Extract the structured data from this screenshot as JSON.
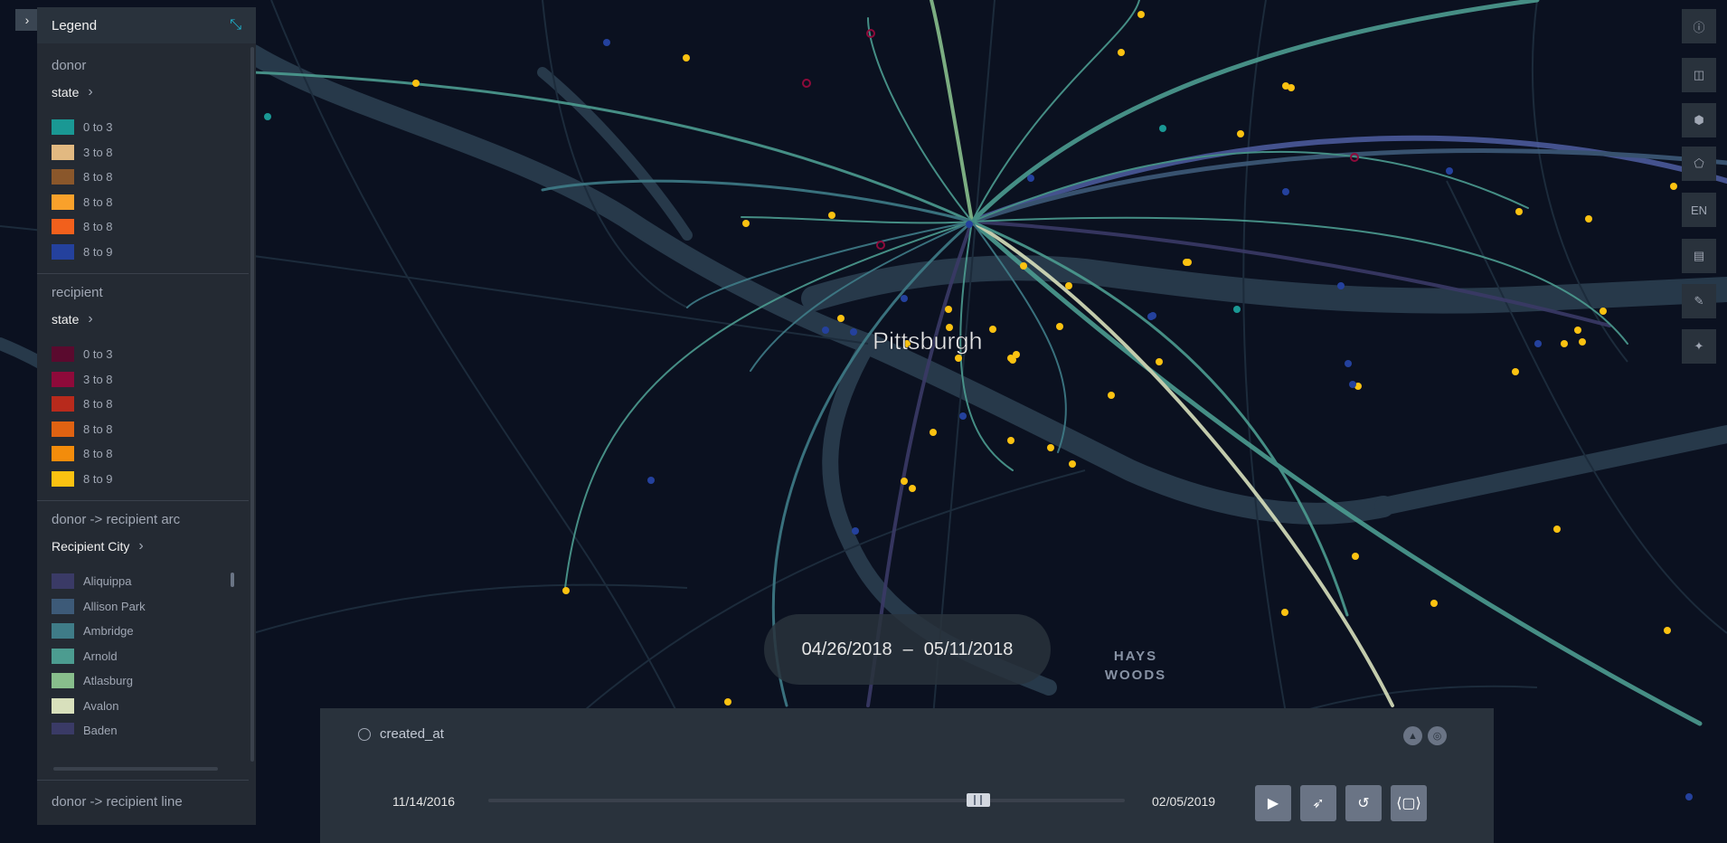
{
  "legend": {
    "title": "Legend",
    "layers": [
      {
        "name": "donor",
        "field": "state",
        "items": [
          {
            "label": "0 to 3",
            "color": "#1a9894"
          },
          {
            "label": "3 to 8",
            "color": "#e2b981"
          },
          {
            "label": "8 to 8",
            "color": "#8a572b"
          },
          {
            "label": "8 to 8",
            "color": "#f9a12b"
          },
          {
            "label": "8 to 8",
            "color": "#f2601c"
          },
          {
            "label": "8 to 9",
            "color": "#24419d"
          }
        ]
      },
      {
        "name": "recipient",
        "field": "state",
        "items": [
          {
            "label": "0 to 3",
            "color": "#5a0a2e"
          },
          {
            "label": "3 to 8",
            "color": "#8e0a3a"
          },
          {
            "label": "8 to 8",
            "color": "#b82a1c"
          },
          {
            "label": "8 to 8",
            "color": "#df6212"
          },
          {
            "label": "8 to 8",
            "color": "#f38c0b"
          },
          {
            "label": "8 to 9",
            "color": "#fbc211"
          }
        ]
      },
      {
        "name": "donor -> recipient arc",
        "field": "Recipient City",
        "items": [
          {
            "label": "Aliquippa",
            "color": "#3a3a66"
          },
          {
            "label": "Allison Park",
            "color": "#3d5a78"
          },
          {
            "label": "Ambridge",
            "color": "#3f7c88"
          },
          {
            "label": "Arnold",
            "color": "#4c9c90"
          },
          {
            "label": "Atlasburg",
            "color": "#88be8c"
          },
          {
            "label": "Avalon",
            "color": "#d8e0bc"
          },
          {
            "label": "Baden",
            "color": "#3a3a66"
          }
        ]
      }
    ],
    "bottom_layer": "donor -> recipient line"
  },
  "map": {
    "city_label": "Pittsburgh",
    "area_label_1": "HAYS",
    "area_label_2": "WOODS"
  },
  "map_controls": [
    "info-icon",
    "split-map-icon",
    "3d-view-icon",
    "draw-polygon-icon",
    "EN",
    "legend-icon",
    "edit-icon",
    "effects-icon"
  ],
  "locale_label": "EN",
  "time_display": {
    "start": "04/26/2018",
    "separator": "–",
    "end": "05/11/2018"
  },
  "time_panel": {
    "field": "created_at",
    "domain_start": "11/14/2016",
    "domain_end": "02/05/2019",
    "range_position_fraction": 0.77
  }
}
